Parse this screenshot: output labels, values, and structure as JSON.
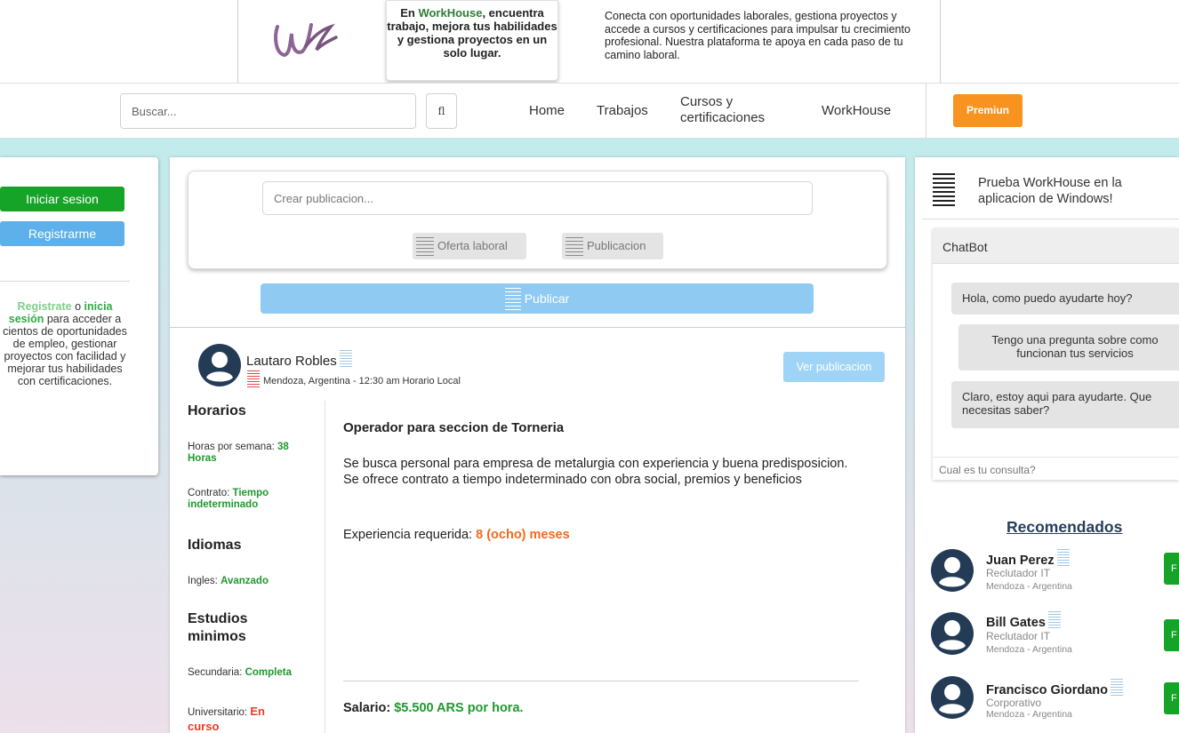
{
  "banner": {
    "tagline_prefix": "En ",
    "tagline_brand": "WorkHouse",
    "tagline_rest": ", encuentra trabajo, mejora tus habilidades y gestiona proyectos en un solo lugar.",
    "description": "Conecta con oportunidades laborales, gestiona proyectos y accede a cursos y certificaciones para impulsar tu crecimiento profesional. Nuestra plataforma te apoya en cada paso de tu camino laboral."
  },
  "navbar": {
    "search_placeholder": "Buscar...",
    "search_button": "fl",
    "links": [
      "Home",
      "Trabajos",
      "Cursos y certificaciones",
      "WorkHouse"
    ],
    "premium": "Premiun"
  },
  "left_card": {
    "login": "Iniciar sesion",
    "register": "Registrarme",
    "cta_register": "Registrate",
    "cta_or": " o ",
    "cta_login": "inicia sesión",
    "cta_rest": " para acceder a cientos de oportunidades de empleo, gestionar proyectos con facilidad y mejorar tus habilidades con certificaciones."
  },
  "composer": {
    "placeholder": "Crear publicacion...",
    "chip_job": "Oferta laboral",
    "chip_post": "Publicacion",
    "publish": "Publicar"
  },
  "post": {
    "author": "Lautaro Robles",
    "location": "Mendoza, Argentina - 12:30 am Horario Local",
    "view_button": "Ver publicacion",
    "schedule_heading": "Horarios",
    "hours_label": "Horas por semana: ",
    "hours_value": "38 Horas",
    "contract_label": "Contrato: ",
    "contract_value": "Tiempo indeterminado",
    "languages_heading": "Idiomas",
    "english_label": "Ingles: ",
    "english_value": "Avanzado",
    "studies_heading": "Estudios minimos",
    "secondary_label": "Secundaria: ",
    "secondary_value": "Completa",
    "university_label": "Universitario: ",
    "university_value": "En curso",
    "title": "Operador para seccion de Torneria",
    "description": "Se busca personal para empresa de metalurgia con experiencia y buena predisposicion. Se ofrece contrato a tiempo indeterminado con obra social, premios y beneficios",
    "experience_label": "Experiencia requerida: ",
    "experience_value": "8 (ocho) meses",
    "salary_label": "Salario: ",
    "salary_value": "$5.500 ARS por hora."
  },
  "right_col": {
    "app_promo": "Prueba WorkHouse en la aplicacion de Windows!",
    "chatbot_title": "ChatBot",
    "chat_messages": [
      "Hola, como puedo ayudarte hoy?",
      "Tengo una pregunta sobre como funcionan tus servicios",
      "Claro, estoy aqui para ayudarte. Que necesitas saber?"
    ],
    "chat_placeholder": "Cual es tu consulta?",
    "recommended_title": "Recomendados",
    "recommended": [
      {
        "name": "Juan Perez",
        "role": "Reclutador IT",
        "location": "Mendoza - Argentina",
        "button": "F"
      },
      {
        "name": "Bill Gates",
        "role": "Reclutador IT",
        "location": "Mendoza - Argentina",
        "button": "F"
      },
      {
        "name": "Francisco Giordano",
        "role": "Corporativo",
        "location": "Mendoza - Argentina",
        "button": "F"
      }
    ]
  },
  "colors": {
    "green": "#15a328",
    "blue": "#5db0ea",
    "premium_orange": "#f7931e",
    "accent_orange": "#f26a1f",
    "navy": "#263e5c"
  }
}
